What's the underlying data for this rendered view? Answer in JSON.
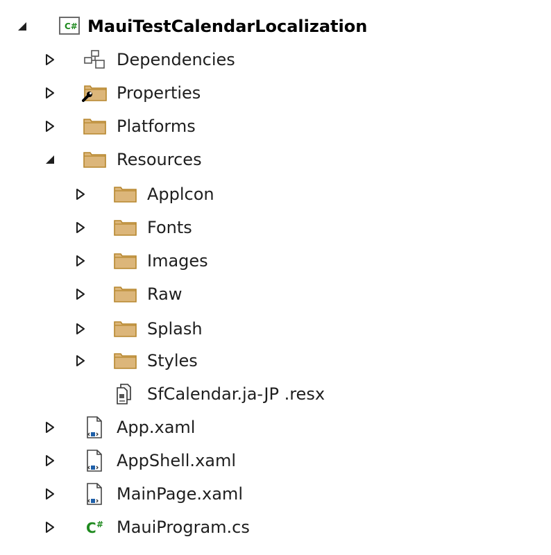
{
  "tree": {
    "project": {
      "label": "MauiTestCalendarLocalization",
      "icon": "csharp-project-icon",
      "expanded": true
    },
    "items": [
      {
        "label": "Dependencies",
        "icon": "dependencies-icon",
        "expanded": false
      },
      {
        "label": "Properties",
        "icon": "properties-folder-icon",
        "expanded": false
      },
      {
        "label": "Platforms",
        "icon": "folder-icon",
        "expanded": false
      },
      {
        "label": "Resources",
        "icon": "folder-icon",
        "expanded": true,
        "children": [
          {
            "label": "Applcon",
            "icon": "folder-icon",
            "expanded": false
          },
          {
            "label": "Fonts",
            "icon": "folder-icon",
            "expanded": false
          },
          {
            "label": "Images",
            "icon": "folder-icon",
            "expanded": false
          },
          {
            "label": "Raw",
            "icon": "folder-icon",
            "expanded": false
          },
          {
            "label": "Splash",
            "icon": "folder-icon",
            "expanded": false
          },
          {
            "label": "Styles",
            "icon": "folder-icon",
            "expanded": false
          },
          {
            "label": "SfCalendar.ja-JP .resx",
            "icon": "resx-file-icon"
          }
        ]
      },
      {
        "label": "App.xaml",
        "icon": "xaml-file-icon",
        "expanded": false
      },
      {
        "label": "AppShell.xaml",
        "icon": "xaml-file-icon",
        "expanded": false
      },
      {
        "label": "MainPage.xaml",
        "icon": "xaml-file-icon",
        "expanded": false
      },
      {
        "label": "MauiProgram.cs",
        "icon": "csharp-file-icon",
        "expanded": false
      }
    ]
  },
  "colors": {
    "folder_fill": "#dcb67a",
    "folder_stroke": "#b6862c",
    "csharp_green": "#1f8a1f",
    "xaml_blue": "#1e5fa8",
    "text": "#1e1e1e",
    "glyph": "#1e1e1e"
  }
}
